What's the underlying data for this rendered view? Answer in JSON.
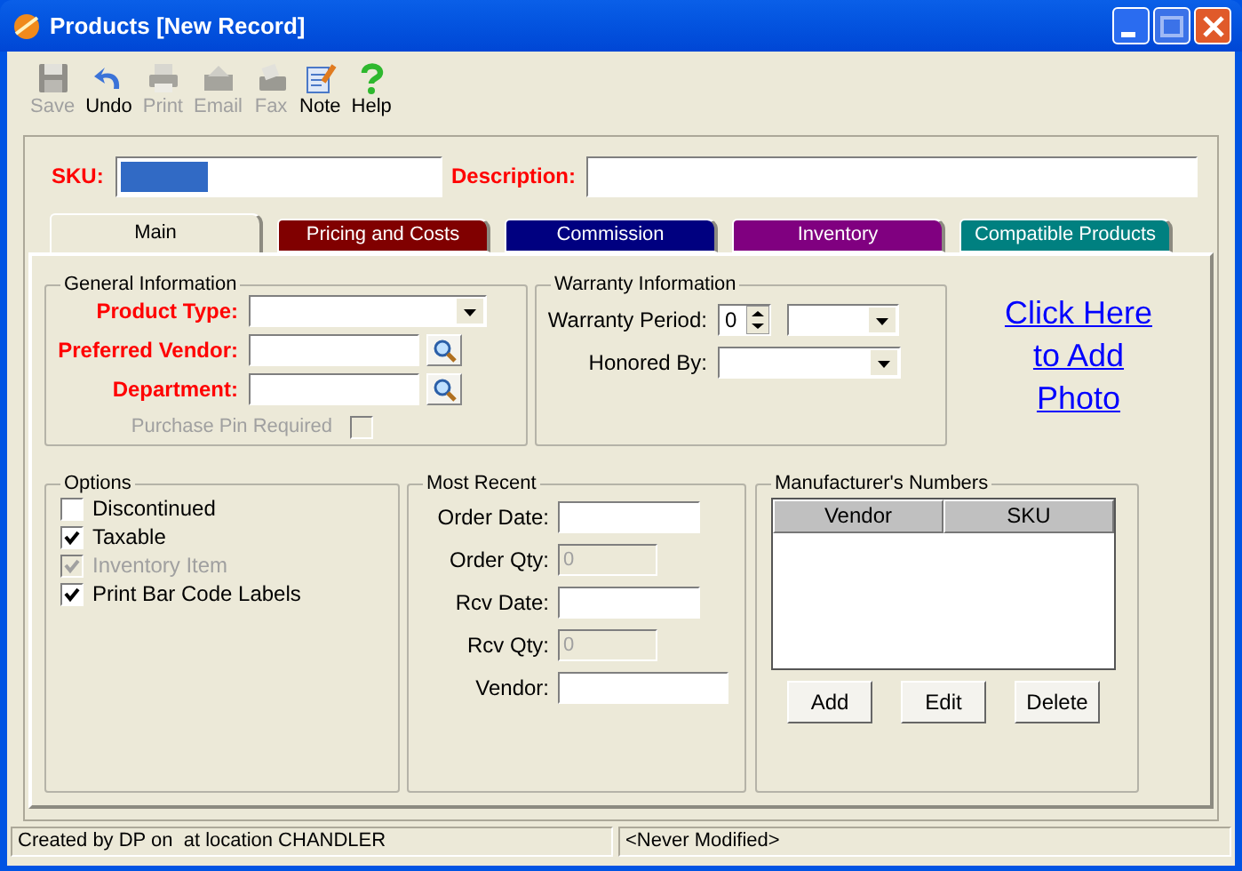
{
  "window": {
    "title": "Products [New Record]"
  },
  "toolbar": [
    {
      "label": "Save",
      "disabled": true
    },
    {
      "label": "Undo",
      "disabled": false
    },
    {
      "label": "Print",
      "disabled": true
    },
    {
      "label": "Email",
      "disabled": true
    },
    {
      "label": "Fax",
      "disabled": true
    },
    {
      "label": "Note",
      "disabled": false
    },
    {
      "label": "Help",
      "disabled": false
    }
  ],
  "sku": {
    "label": "SKU:",
    "focused": true
  },
  "description": {
    "label": "Description:"
  },
  "tabs": [
    {
      "label": "Main",
      "color": "#ece9d8",
      "selected": true
    },
    {
      "label": "Pricing and Costs",
      "color": "#800000",
      "selected": false
    },
    {
      "label": "Commission",
      "color": "#000080",
      "selected": false
    },
    {
      "label": "Inventory",
      "color": "#800080",
      "selected": false
    },
    {
      "label": "Compatible Products",
      "color": "#008080",
      "selected": false
    }
  ],
  "general": {
    "title": "General Information",
    "fields": [
      {
        "label": "Product Type:",
        "kind": "dropdown",
        "required": true
      },
      {
        "label": "Preferred Vendor:",
        "kind": "lookup",
        "required": true
      },
      {
        "label": "Department:",
        "kind": "lookup",
        "required": true
      }
    ],
    "purchase_pin": {
      "label": "Purchase Pin Required",
      "checked": false,
      "disabled": true
    }
  },
  "warranty": {
    "title": "Warranty Information",
    "period": {
      "label": "Warranty Period:",
      "value": "0"
    },
    "honored_by": {
      "label": "Honored By:"
    }
  },
  "photo_link": "Click Here to Add Photo",
  "options": {
    "title": "Options",
    "items": [
      {
        "label": "Discontinued",
        "checked": false,
        "disabled": false
      },
      {
        "label": "Taxable",
        "checked": true,
        "disabled": false
      },
      {
        "label": "Inventory Item",
        "checked": true,
        "disabled": true
      },
      {
        "label": "Print Bar Code Labels",
        "checked": true,
        "disabled": false
      }
    ]
  },
  "most_recent": {
    "title": "Most Recent",
    "fields": [
      {
        "label": "Order Date:",
        "kind": "date",
        "disabled": false
      },
      {
        "label": "Order Qty:",
        "kind": "qty",
        "value": "0",
        "disabled": true
      },
      {
        "label": "Rcv Date:",
        "kind": "date",
        "disabled": false
      },
      {
        "label": "Rcv Qty:",
        "kind": "qty",
        "value": "0",
        "disabled": true
      },
      {
        "label": "Vendor:",
        "kind": "text",
        "disabled": false
      }
    ]
  },
  "manufacturers": {
    "title": "Manufacturer's Numbers",
    "columns": [
      "Vendor",
      "SKU"
    ],
    "buttons": [
      "Add",
      "Edit",
      "Delete"
    ]
  },
  "status_bar": [
    "Created by DP on  at location CHANDLER",
    "<Never Modified>"
  ]
}
